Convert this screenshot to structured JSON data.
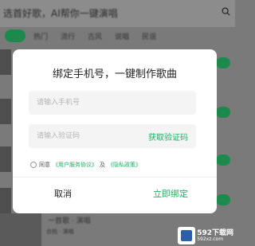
{
  "background": {
    "header_text": "选首好歌，AI帮你一键演唱",
    "tabs": [
      "热门",
      "流行",
      "古风",
      "说唱",
      "民谣"
    ],
    "bottom_title": "一首歌 · 演唱",
    "bottom_sub": "合拍 · 演唱"
  },
  "dialog": {
    "title": "绑定手机号，一键制作歌曲",
    "phone_placeholder": "请输入手机号",
    "code_placeholder": "请输入验证码",
    "get_code_label": "获取验证码",
    "agree_prefix": "同意",
    "agreement_link": "《用户服务协议》",
    "agree_and": "及",
    "privacy_link": "《隐私政策》",
    "cancel_label": "取消",
    "confirm_label": "立即绑定"
  },
  "watermark": {
    "number": "592下载网",
    "sub": "592xz.com"
  },
  "colors": {
    "accent": "#22b062",
    "overlay": "#7a7a7a"
  }
}
